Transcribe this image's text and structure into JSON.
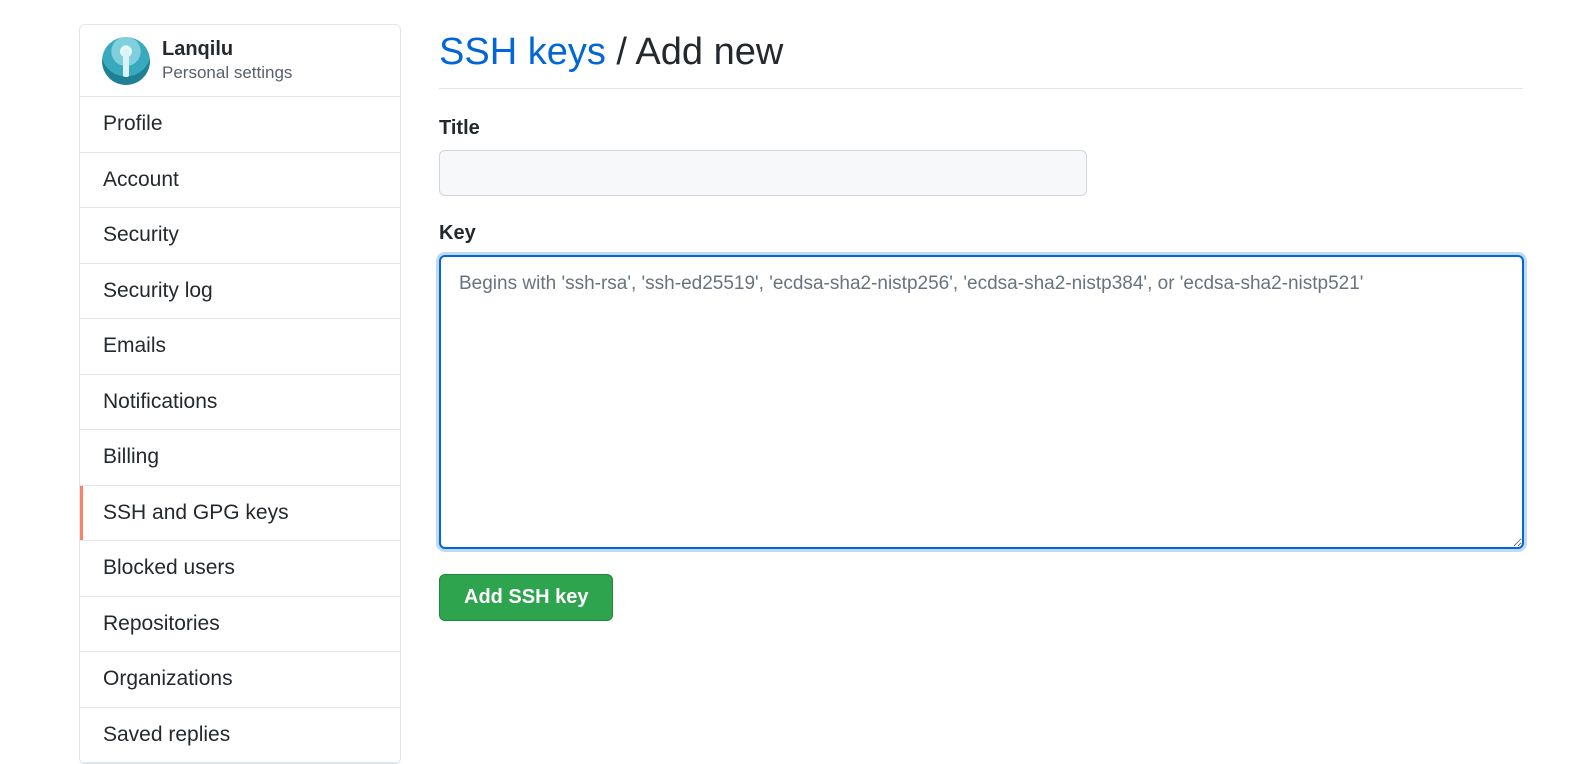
{
  "sidebar": {
    "user_name": "Lanqilu",
    "user_subtitle": "Personal settings",
    "items": [
      {
        "label": "Profile"
      },
      {
        "label": "Account"
      },
      {
        "label": "Security"
      },
      {
        "label": "Security log"
      },
      {
        "label": "Emails"
      },
      {
        "label": "Notifications"
      },
      {
        "label": "Billing"
      },
      {
        "label": "SSH and GPG keys",
        "selected": true
      },
      {
        "label": "Blocked users"
      },
      {
        "label": "Repositories"
      },
      {
        "label": "Organizations"
      },
      {
        "label": "Saved replies"
      }
    ]
  },
  "main": {
    "heading_link": "SSH keys",
    "heading_separator": " / ",
    "heading_text": "Add new",
    "title_label": "Title",
    "title_value": "",
    "key_label": "Key",
    "key_value": "",
    "key_placeholder": "Begins with 'ssh-rsa', 'ssh-ed25519', 'ecdsa-sha2-nistp256', 'ecdsa-sha2-nistp384', or 'ecdsa-sha2-nistp521'",
    "submit_label": "Add SSH key"
  },
  "colors": {
    "link": "#0366d6",
    "selected_marker": "#f9826c",
    "button_green": "#2ea44f"
  }
}
